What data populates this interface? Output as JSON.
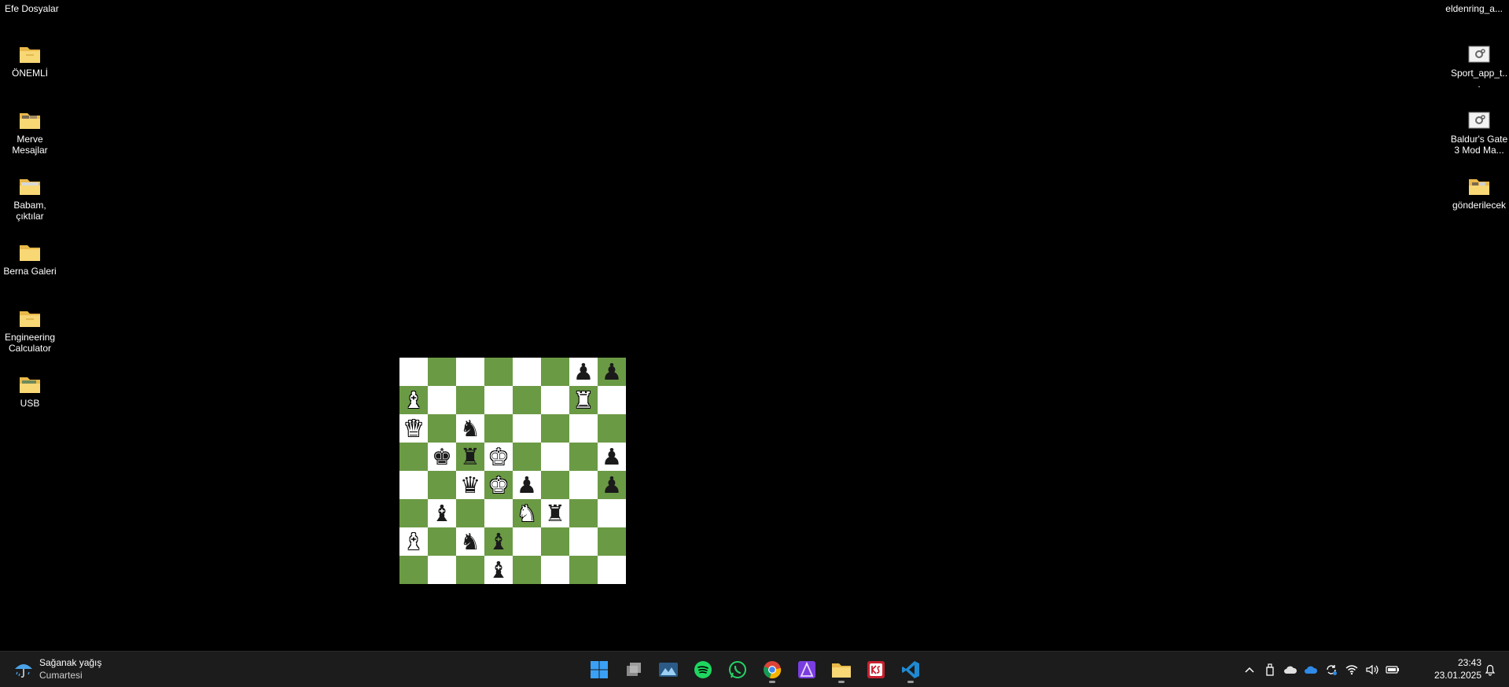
{
  "desktop": {
    "corner_left": "Efe Dosyalar",
    "corner_right": "eldenring_a...",
    "left_icons": [
      {
        "label": "ÖNEMLİ",
        "icon": "folder-icon"
      },
      {
        "label": "Merve Mesajlar",
        "icon": "folder-icon"
      },
      {
        "label": "Babam, çıktılar",
        "icon": "folder-icon"
      },
      {
        "label": "Berna Galeri",
        "icon": "folder-icon"
      },
      {
        "label": "Engineering Calculator",
        "icon": "folder-icon"
      },
      {
        "label": "USB",
        "icon": "folder-icon"
      }
    ],
    "right_icons": [
      {
        "label": "Sport_app_t...",
        "icon": "settings-file-icon"
      },
      {
        "label": "Baldur's Gate 3 Mod Ma...",
        "icon": "settings-file-icon"
      },
      {
        "label": "gönderilecek",
        "icon": "folder-icon"
      }
    ]
  },
  "chessboard": {
    "colors": {
      "light": "#ffffff",
      "dark": "#6b9a45"
    },
    "rows": [
      [
        "",
        "",
        "",
        "",
        "",
        "",
        "bP",
        "bP"
      ],
      [
        "wB",
        "",
        "",
        "",
        "",
        "",
        "wR",
        ""
      ],
      [
        "wQ",
        "",
        "bN",
        "",
        "",
        "",
        "",
        ""
      ],
      [
        "",
        "bK",
        "bR",
        "wK",
        "",
        "",
        "",
        "bP"
      ],
      [
        "",
        "",
        "bQ",
        "wK",
        "bP",
        "",
        "",
        "bP"
      ],
      [
        "",
        "bB",
        "",
        "",
        "wN",
        "bR",
        "",
        ""
      ],
      [
        "wB",
        "",
        "bN",
        "bB",
        "",
        "",
        "",
        ""
      ],
      [
        "",
        "",
        "",
        "bB",
        "",
        "",
        "",
        ""
      ]
    ]
  },
  "taskbar": {
    "weather": {
      "condition": "Sağanak yağış",
      "day": "Cumartesi",
      "icon": "rain-umbrella-icon"
    },
    "apps": [
      {
        "name": "start-button",
        "icon": "windows-logo-icon",
        "running": false
      },
      {
        "name": "task-view",
        "icon": "task-view-icon",
        "running": false
      },
      {
        "name": "photos-app",
        "icon": "photos-icon",
        "running": false
      },
      {
        "name": "spotify-app",
        "icon": "spotify-icon",
        "running": false
      },
      {
        "name": "whatsapp-app",
        "icon": "whatsapp-icon",
        "running": false
      },
      {
        "name": "chrome-app",
        "icon": "chrome-icon",
        "running": true
      },
      {
        "name": "affinity-app",
        "icon": "affinity-icon",
        "running": false
      },
      {
        "name": "file-explorer-app",
        "icon": "folder-icon",
        "running": true
      },
      {
        "name": "ks-app",
        "icon": "ks-icon",
        "running": false
      },
      {
        "name": "vscode-app",
        "icon": "vscode-icon",
        "running": true
      }
    ],
    "tray": [
      "chevron-up-icon",
      "usb-drive-icon",
      "cloud-icon",
      "onedrive-icon",
      "sync-icon",
      "wifi-icon",
      "volume-icon",
      "battery-icon"
    ],
    "clock": {
      "time": "23:43",
      "date": "23.01.2025"
    }
  }
}
